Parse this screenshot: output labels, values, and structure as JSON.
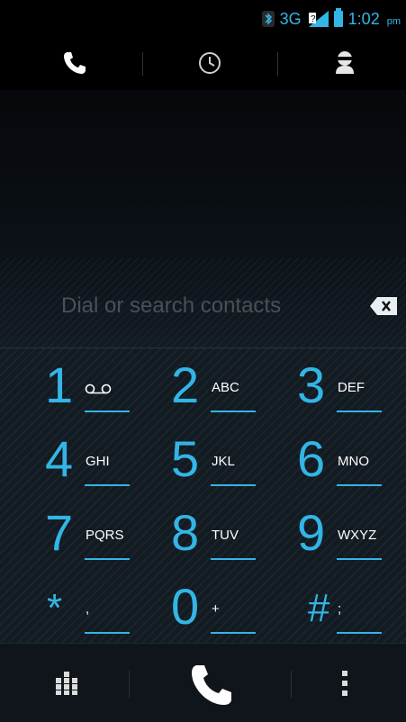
{
  "status_bar": {
    "network": "3G",
    "time": "1:02",
    "ampm": "pm"
  },
  "tabs": [
    {
      "name": "phone",
      "icon": "phone-icon",
      "active": true
    },
    {
      "name": "recent",
      "icon": "clock-icon",
      "active": false
    },
    {
      "name": "contacts",
      "icon": "person-icon",
      "active": false
    }
  ],
  "search": {
    "placeholder": "Dial or search contacts",
    "backspace_icon": "backspace-icon"
  },
  "keys": [
    {
      "digit": "1",
      "letters": "QO"
    },
    {
      "digit": "2",
      "letters": "ABC"
    },
    {
      "digit": "3",
      "letters": "DEF"
    },
    {
      "digit": "4",
      "letters": "GHI"
    },
    {
      "digit": "5",
      "letters": "JKL"
    },
    {
      "digit": "6",
      "letters": "MNO"
    },
    {
      "digit": "7",
      "letters": "PQRS"
    },
    {
      "digit": "8",
      "letters": "TUV"
    },
    {
      "digit": "9",
      "letters": "WXYZ"
    },
    {
      "digit": "*",
      "letters": ","
    },
    {
      "digit": "0",
      "letters": "+"
    },
    {
      "digit": "#",
      "letters": ";"
    }
  ],
  "bottom": {
    "left_icon": "dialpad-icon",
    "center_icon": "call-icon",
    "right_icon": "overflow-menu-icon"
  },
  "colors": {
    "accent": "#33b5e5",
    "background": "#000000"
  }
}
